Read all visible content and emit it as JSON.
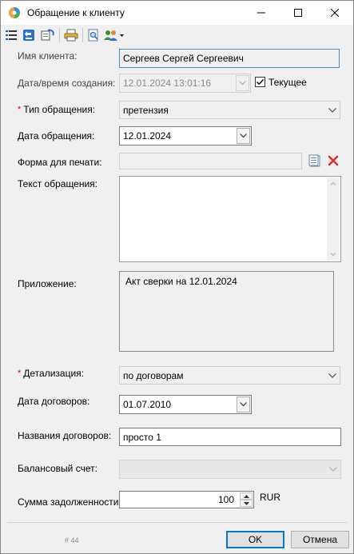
{
  "window": {
    "title": "Обращение к клиенту"
  },
  "toolbar": {
    "icons": [
      "list-icon",
      "back-icon",
      "refresh-icon",
      "printer-icon",
      "preview-icon",
      "users-dropdown-icon"
    ]
  },
  "form": {
    "client_name": {
      "label": "Имя клиента:",
      "value": "Сергеев Сергей Сергеевич"
    },
    "created": {
      "label": "Дата/время создания:",
      "value": "12.01.2024 13:01:16",
      "current_label": "Текущее",
      "current_checked": true
    },
    "request_type": {
      "label": "Тип обращения:",
      "value": "претензия",
      "required": true
    },
    "request_date": {
      "label": "Дата обращения:",
      "value": "12.01.2024"
    },
    "print_form": {
      "label": "Форма для печати:",
      "value": ""
    },
    "request_text": {
      "label": "Текст обращения:",
      "value": ""
    },
    "attachment": {
      "label": "Приложение:",
      "value": "Акт сверки на 12.01.2024"
    },
    "detail": {
      "label": "Детализация:",
      "value": "по договорам",
      "required": true
    },
    "contracts_date": {
      "label": "Дата договоров:",
      "value": "01.07.2010"
    },
    "contracts_names": {
      "label": "Названия договоров:",
      "value": "просто 1"
    },
    "balance_account": {
      "label": "Балансовый счет:",
      "value": ""
    },
    "debt_amount": {
      "label": "Сумма задолженности:",
      "value": "100",
      "currency": "RUR"
    }
  },
  "footer": {
    "record_id": "# 44",
    "ok_label": "OK",
    "cancel_label": "Отмена"
  },
  "colors": {
    "accent": "#0078d7",
    "required": "#dd0000",
    "delete_icon": "#e03030"
  }
}
